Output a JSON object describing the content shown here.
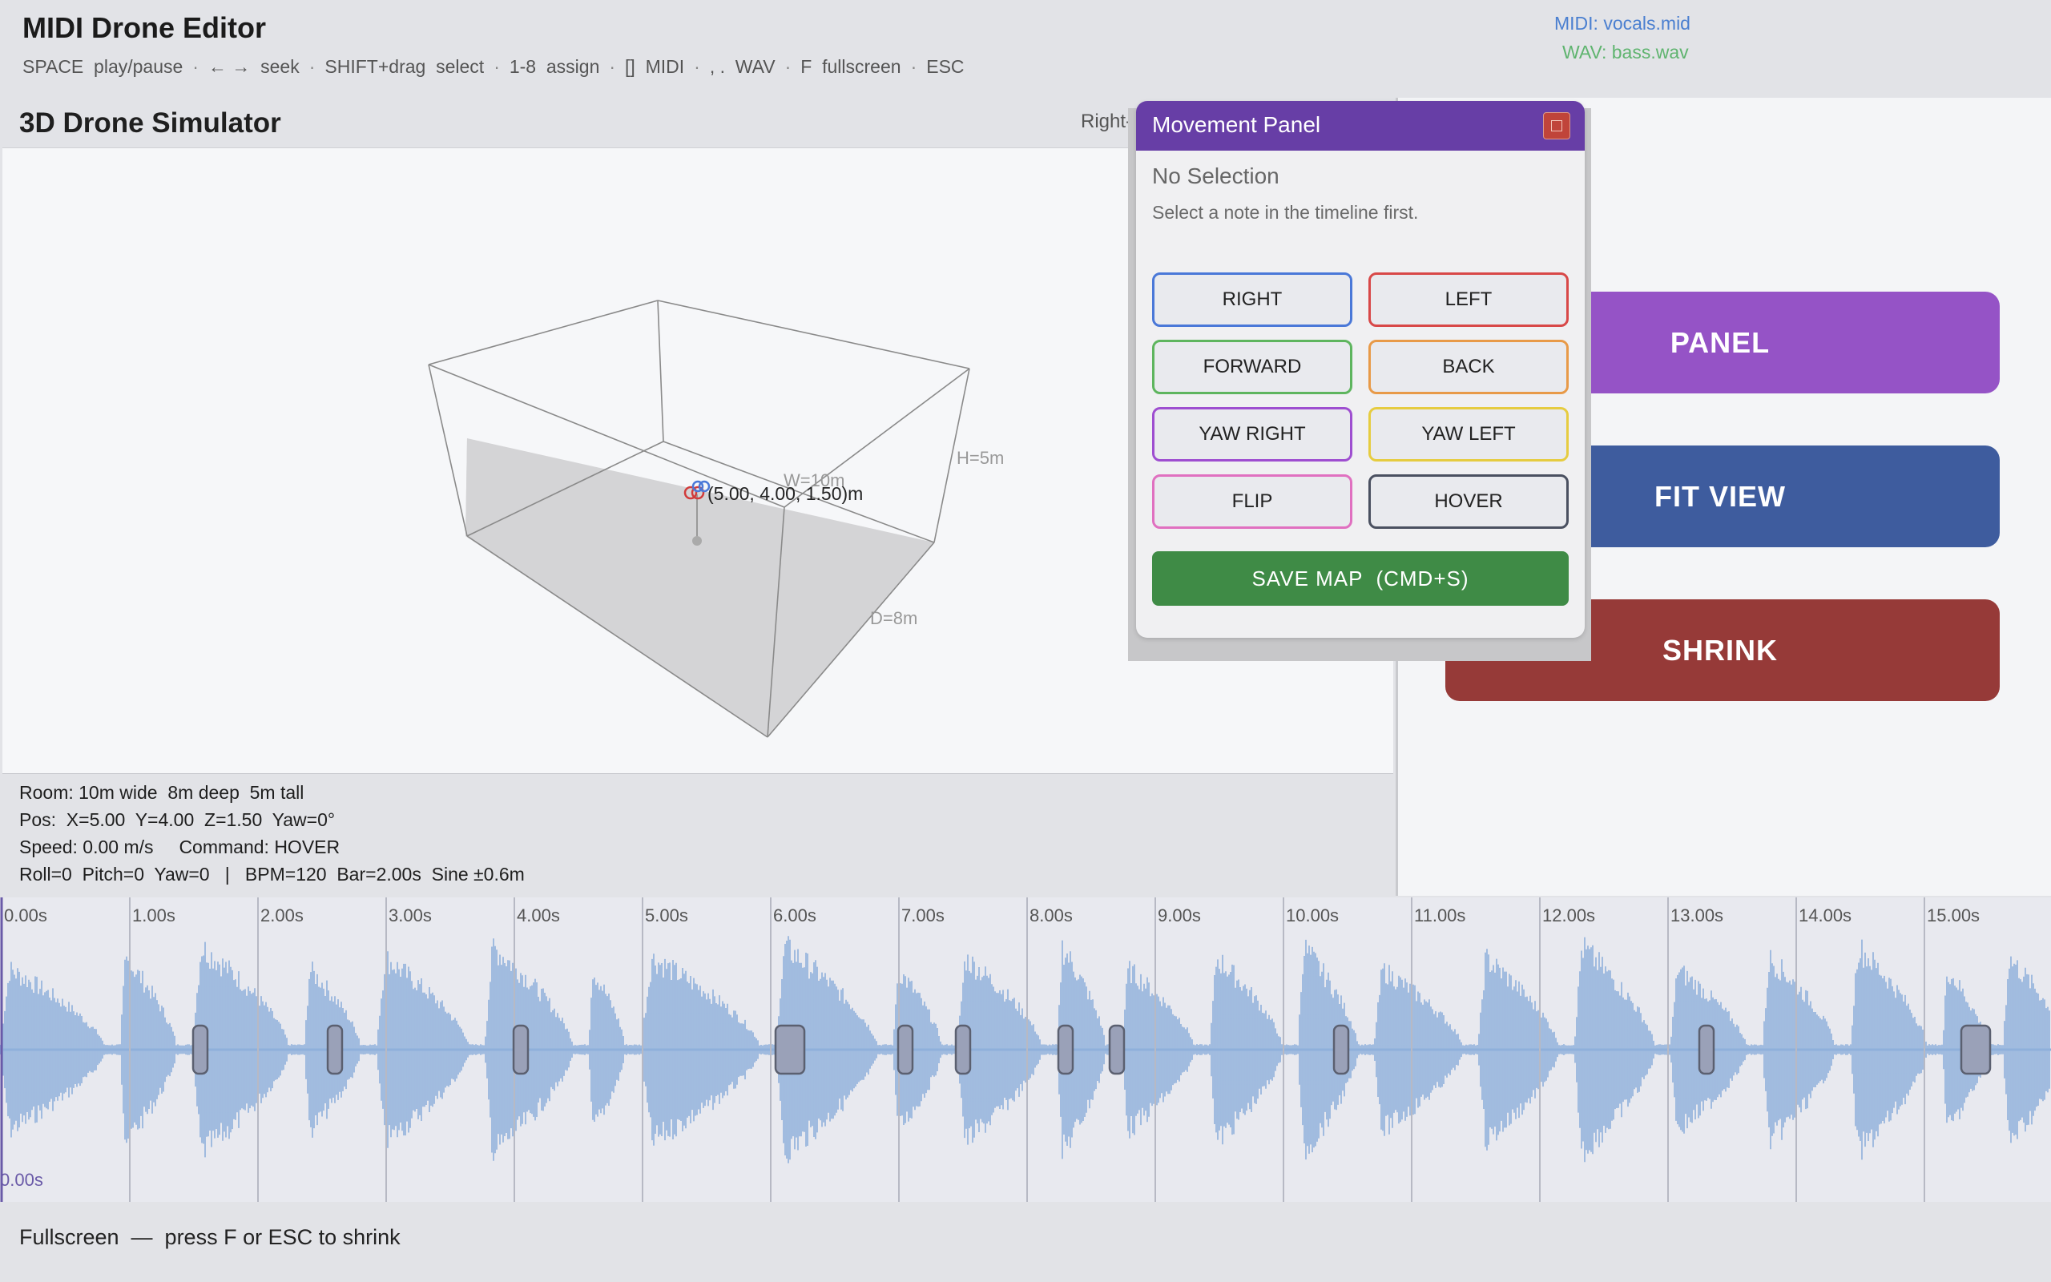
{
  "app": {
    "title": "MIDI Drone Editor",
    "shortcuts": [
      "SPACE  play/pause",
      "← →  seek",
      "SHIFT+drag  select",
      "1-8  assign",
      "[]  MIDI",
      ", .  WAV",
      "F  fullscreen",
      "ESC"
    ],
    "shortcut_separator": "·",
    "midi_file": "MIDI: vocals.mid",
    "wav_file": "WAV:  bass.wav"
  },
  "simulator": {
    "title": "3D Drone Simulator",
    "hint": "Right-",
    "room_labels": {
      "width": "W=10m",
      "height": "H=5m",
      "depth": "D=8m"
    },
    "drone_position_label": "(5.00, 4.00, 1.50)m",
    "stats": [
      "Room: 10m wide  8m deep  5m tall",
      "Pos:  X=5.00  Y=4.00  Z=1.50  Yaw=0°",
      "Speed: 0.00 m/s     Command: HOVER",
      "Roll=0  Pitch=0  Yaw=0   |   BPM=120  Bar=2.00s  Sine ±0.6m"
    ]
  },
  "movement_panel": {
    "title": "Movement Panel",
    "status": "No Selection",
    "hint": "Select a note in the timeline first.",
    "buttons": [
      {
        "label": "RIGHT",
        "color": "#4a78d8"
      },
      {
        "label": "LEFT",
        "color": "#d84848"
      },
      {
        "label": "FORWARD",
        "color": "#5eb55e"
      },
      {
        "label": "BACK",
        "color": "#e89a48"
      },
      {
        "label": "YAW RIGHT",
        "color": "#9e4ed0"
      },
      {
        "label": "YAW LEFT",
        "color": "#e6cc40"
      },
      {
        "label": "FLIP",
        "color": "#e070c0"
      },
      {
        "label": "HOVER",
        "color": "#4a5060"
      }
    ],
    "save_label": "SAVE MAP  (CMD+S)"
  },
  "side_buttons": {
    "panel": "PANEL",
    "fit_view": "FIT VIEW",
    "shrink": "SHRINK"
  },
  "timeline": {
    "time_labels": [
      "0.00s",
      "1.00s",
      "2.00s",
      "3.00s",
      "4.00s",
      "5.00s",
      "6.00s",
      "7.00s",
      "8.00s",
      "9.00s",
      "10.00s",
      "11.00s",
      "12.00s",
      "13.00s",
      "14.00s",
      "15.00s"
    ],
    "playhead_label": "0.00s",
    "note_markers_s": [
      1.55,
      2.6,
      4.05,
      6.15,
      7.05,
      7.5,
      8.3,
      8.7,
      10.45,
      13.3,
      15.4
    ],
    "waveform_color": "#8fb0db",
    "marker_color": "#9aa1b8"
  },
  "footer": {
    "text": "Fullscreen  —  press F or ESC to shrink"
  }
}
